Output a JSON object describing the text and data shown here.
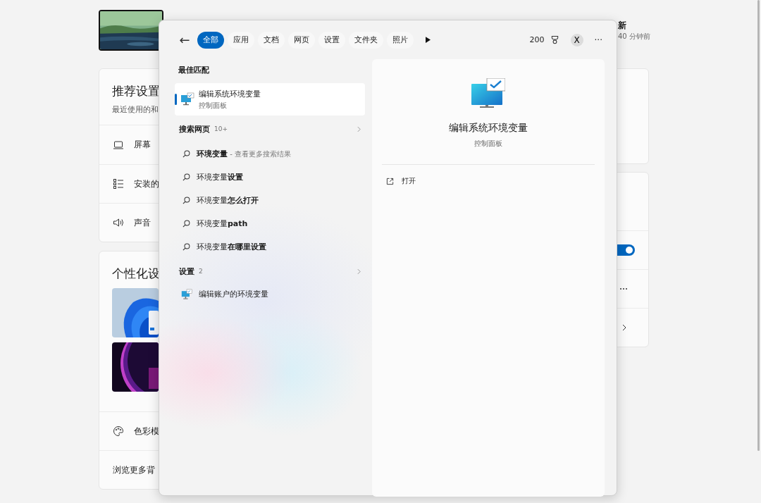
{
  "settings_page": {
    "header": {
      "update_title": "新",
      "update_time": "40 分钟前"
    },
    "recommended": {
      "title": "推荐设置",
      "subtitle": "最近使用的和",
      "rows": [
        {
          "label": "屏幕",
          "kind": "laptop"
        },
        {
          "label": "安装的",
          "kind": "list"
        },
        {
          "label": "声音",
          "kind": "speaker"
        }
      ]
    },
    "personalize": {
      "title": "个性化设",
      "rows": [
        {
          "label": "色彩模",
          "kind": "palette"
        },
        {
          "label": "浏览更多背",
          "kind": "none"
        }
      ]
    },
    "right_card": {
      "rows": [
        {
          "kind": "toggle",
          "on": true
        },
        {
          "kind": "more"
        },
        {
          "kind": "chevron"
        }
      ]
    }
  },
  "search": {
    "back": "←",
    "tabs": [
      {
        "label": "全部",
        "selected": true
      },
      {
        "label": "应用",
        "selected": false
      },
      {
        "label": "文档",
        "selected": false
      },
      {
        "label": "网页",
        "selected": false
      },
      {
        "label": "设置",
        "selected": false
      },
      {
        "label": "文件夹",
        "selected": false
      },
      {
        "label": "照片",
        "selected": false
      }
    ],
    "points": "200",
    "avatar": "X",
    "more": "···",
    "best_match": {
      "heading": "最佳匹配",
      "title": "编辑系统环境变量",
      "subtitle": "控制面板",
      "selected": true
    },
    "web": {
      "heading": "搜索网页",
      "count": "10+",
      "items": [
        {
          "text": "**环境变量**",
          "hint": " - 查看更多搜索结果"
        },
        {
          "text": "环境变量**设置**"
        },
        {
          "text": "环境变量**怎么打开**"
        },
        {
          "text": "环境变量**path**"
        },
        {
          "text": "环境变量**在哪里设置**"
        }
      ]
    },
    "settings": {
      "heading": "设置",
      "count": "2",
      "items": [
        {
          "text": "编辑账户的环境变量"
        }
      ]
    },
    "preview": {
      "title": "编辑系统环境变量",
      "subtitle": "控制面板",
      "actions": [
        {
          "label": "打开"
        }
      ]
    }
  }
}
